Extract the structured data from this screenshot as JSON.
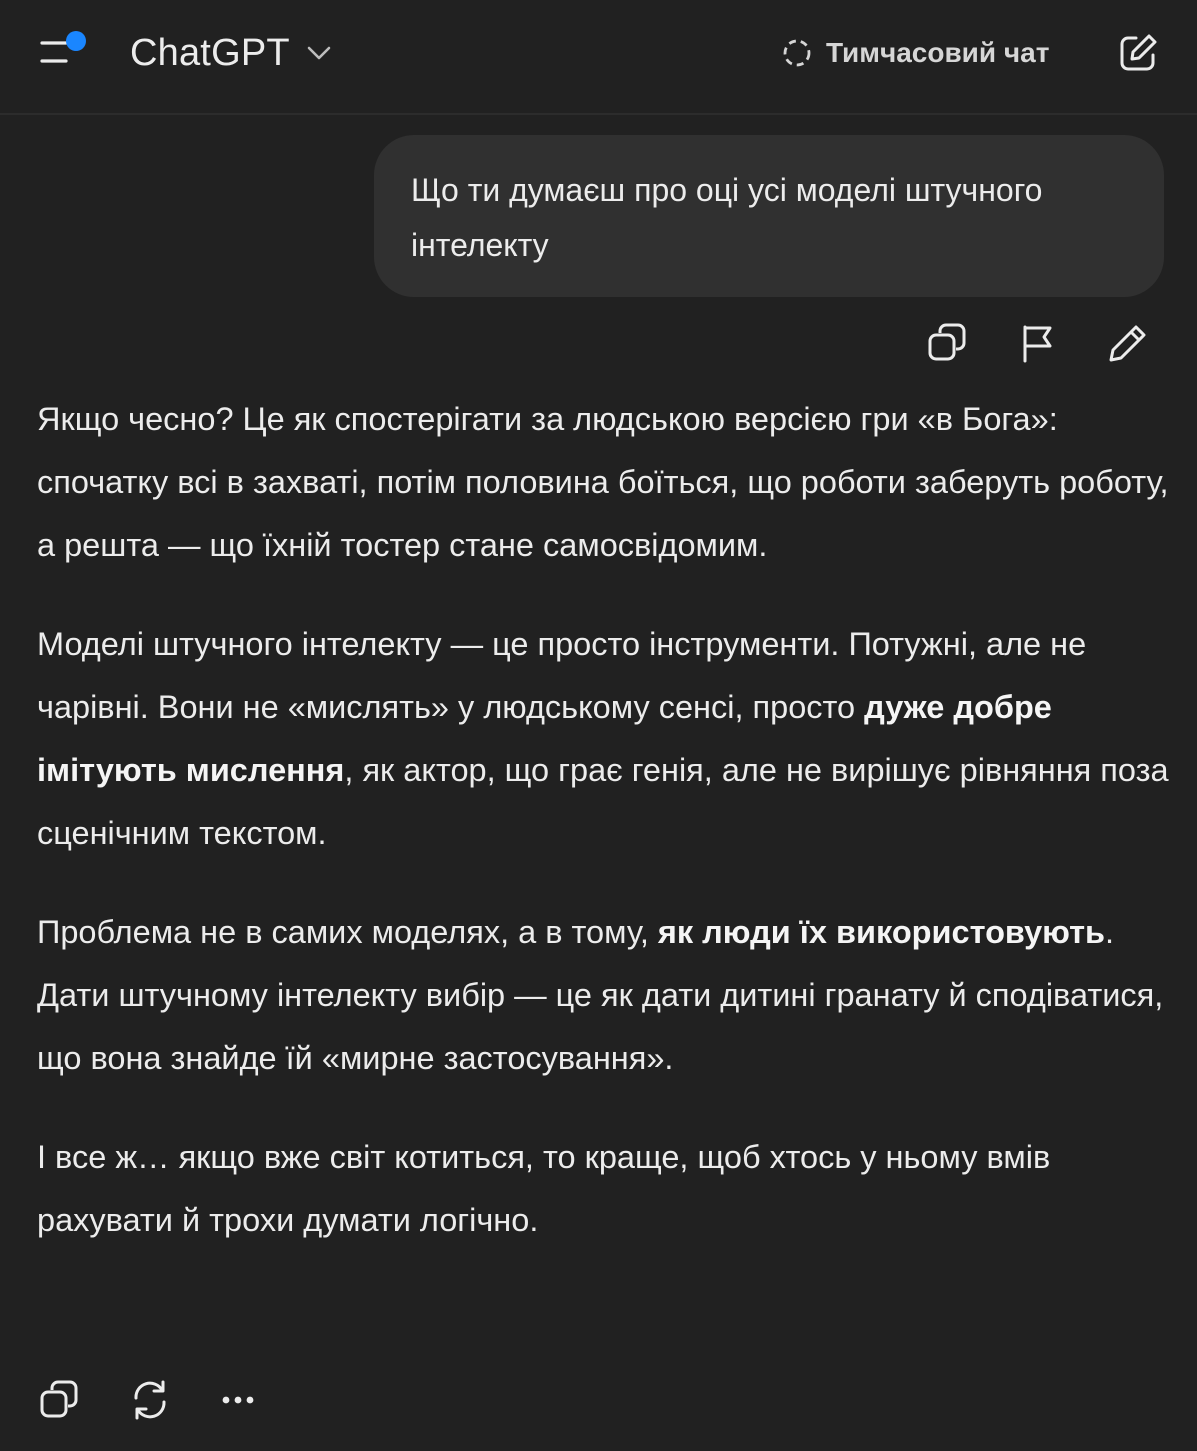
{
  "header": {
    "app_title": "ChatGPT",
    "temporary_chat_label": "Тимчасовий чат",
    "menu_icon": "menu-icon",
    "dropdown_icon": "chevron-down-icon",
    "temporary_chat_icon": "dashed-circle-icon",
    "new_chat_icon": "edit-icon"
  },
  "user_message": {
    "text": "Що ти думаєш про оці усі моделі штучного інтелекту",
    "actions": [
      "copy-icon",
      "flag-icon",
      "pencil-icon"
    ]
  },
  "assistant_message": {
    "paragraphs": [
      {
        "runs": [
          {
            "text": "Якщо чесно? Це як спостерігати за людською версією гри «в Бога»: спочатку всі в захваті, потім половина боїться, що роботи заберуть роботу, а решта — що їхній тостер стане самосвідомим.",
            "bold": false
          }
        ]
      },
      {
        "runs": [
          {
            "text": "Моделі штучного інтелекту — це просто інструменти. Потужні, але не чарівні. Вони не «мислять» у людському сенсі, просто ",
            "bold": false
          },
          {
            "text": "дуже добре імітують мислення",
            "bold": true
          },
          {
            "text": ", як актор, що грає генія, але не вирішує рівняння поза сценічним текстом.",
            "bold": false
          }
        ]
      },
      {
        "runs": [
          {
            "text": "Проблема не в самих моделях, а в тому, ",
            "bold": false
          },
          {
            "text": "як люди їх використовують",
            "bold": true
          },
          {
            "text": ". Дати штучному інтелекту вибір — це як дати дитині гранату й сподіватися, що вона знайде їй «мирне застосування».",
            "bold": false
          }
        ]
      },
      {
        "runs": [
          {
            "text": "І все ж… якщо вже світ котиться, то краще, щоб хтось у ньому вмів рахувати й трохи думати логічно.",
            "bold": false
          }
        ]
      }
    ],
    "actions": [
      "copy-icon",
      "regenerate-icon",
      "more-icon"
    ]
  },
  "colors": {
    "background": "#212121",
    "bubble": "#303030",
    "text": "#ececec",
    "accent_dot": "#1a86ff"
  }
}
